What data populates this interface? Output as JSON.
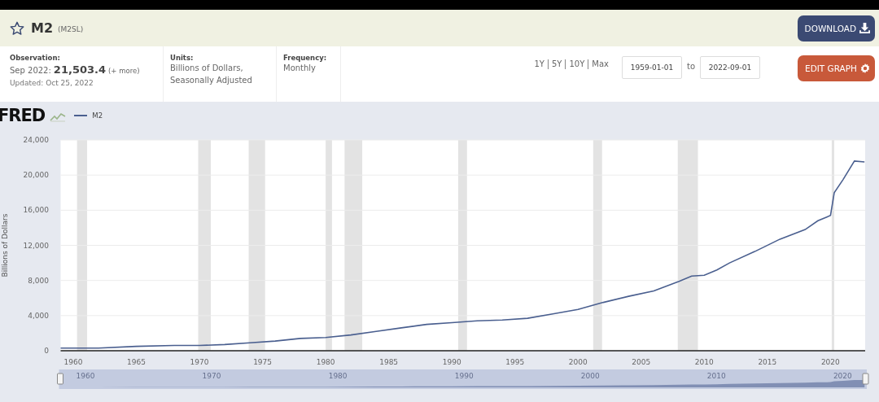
{
  "header": {
    "title": "M2",
    "series_id": "(M2SL)",
    "favorite": false,
    "download_button": "DOWNLOAD"
  },
  "info": {
    "observation": {
      "label": "Observation:",
      "date": "Sep 2022:",
      "value": "21,503.4",
      "more": "(+ more)",
      "updated": "Updated: Oct 25, 2022"
    },
    "units": {
      "label": "Units:",
      "value": "Billions of Dollars, Seasonally Adjusted"
    },
    "frequency": {
      "label": "Frequency:",
      "value": "Monthly"
    },
    "range_links": [
      "1Y",
      "5Y",
      "10Y",
      "Max"
    ],
    "start_date": "1959-01-01",
    "to": "to",
    "end_date": "2022-09-01",
    "edit_button": "EDIT GRAPH"
  },
  "chart": {
    "logo": "FRED",
    "chart_data": {
      "type": "line",
      "ylabel": "Billions of Dollars",
      "x": [
        1959,
        1960,
        1962,
        1965,
        1968,
        1970,
        1972,
        1974,
        1976,
        1978,
        1980,
        1982,
        1984,
        1986,
        1988,
        1990,
        1992,
        1994,
        1996,
        1998,
        2000,
        2002,
        2004,
        2006,
        2008,
        2009,
        2010,
        2011,
        2012,
        2014,
        2016,
        2018,
        2019,
        2020,
        2020.3,
        2021,
        2021.9,
        2022.7
      ],
      "series": [
        {
          "name": "M2",
          "color": "#4a5f8f",
          "values": [
            300,
            300,
            300,
            500,
            600,
            600,
            700,
            900,
            1100,
            1400,
            1500,
            1800,
            2200,
            2600,
            3000,
            3200,
            3400,
            3500,
            3700,
            4200,
            4700,
            5500,
            6200,
            6800,
            7900,
            8500,
            8600,
            9200,
            10000,
            11300,
            12700,
            13800,
            14800,
            15400,
            18000,
            19500,
            21600,
            21500
          ]
        }
      ],
      "grid": true,
      "xlim": [
        1959,
        2022.75
      ],
      "ylim": [
        0,
        24000
      ],
      "xticks": [
        1960,
        1965,
        1970,
        1975,
        1980,
        1985,
        1990,
        1995,
        2000,
        2005,
        2010,
        2015,
        2020
      ],
      "yticks": [
        {
          "value": 0,
          "label": "0"
        },
        {
          "value": 4000,
          "label": "4,000"
        },
        {
          "value": 8000,
          "label": "8,000"
        },
        {
          "value": 12000,
          "label": "12,000"
        },
        {
          "value": 16000,
          "label": "16,000"
        },
        {
          "value": 20000,
          "label": "20,000"
        },
        {
          "value": 24000,
          "label": "24,000"
        }
      ],
      "bands": [
        {
          "axis": "x",
          "from": 1960.3,
          "to": 1961.1,
          "color": "#e3e3e3"
        },
        {
          "axis": "x",
          "from": 1969.9,
          "to": 1970.9,
          "color": "#e3e3e3"
        },
        {
          "axis": "x",
          "from": 1973.9,
          "to": 1975.2,
          "color": "#e3e3e3"
        },
        {
          "axis": "x",
          "from": 1980.0,
          "to": 1980.5,
          "color": "#e3e3e3"
        },
        {
          "axis": "x",
          "from": 1981.5,
          "to": 1982.9,
          "color": "#e3e3e3"
        },
        {
          "axis": "x",
          "from": 1990.5,
          "to": 1991.2,
          "color": "#e3e3e3"
        },
        {
          "axis": "x",
          "from": 2001.2,
          "to": 2001.9,
          "color": "#e3e3e3"
        },
        {
          "axis": "x",
          "from": 2007.9,
          "to": 2009.5,
          "color": "#e3e3e3"
        },
        {
          "axis": "x",
          "from": 2020.1,
          "to": 2020.3,
          "color": "#e3e3e3"
        }
      ]
    },
    "navigator": {
      "labels": [
        "1960",
        "1970",
        "1980",
        "1990",
        "2000",
        "2010",
        "2020"
      ]
    }
  }
}
